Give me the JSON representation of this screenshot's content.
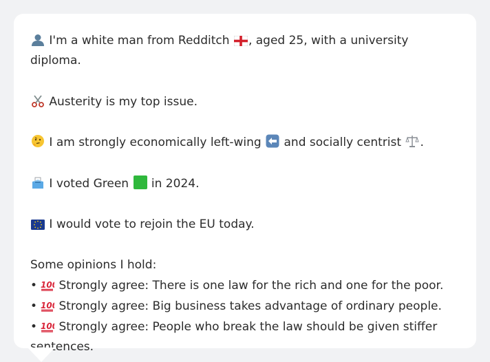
{
  "profile": {
    "identity": {
      "icon": "person-silhouette-icon",
      "text_before_flag": "I'm a white man from Redditch",
      "flag_icon": "england-flag-icon",
      "text_after_flag": ", aged 25, with a university diploma."
    },
    "top_issue": {
      "icon": "scissors-icon",
      "text": "Austerity is my top issue."
    },
    "ideology": {
      "icon": "thinking-face-icon",
      "text_before_arrow": "I am strongly economically left-wing",
      "arrow_icon": "left-arrow-icon",
      "text_middle": "and socially centrist",
      "scales_icon": "balance-scale-icon",
      "text_after": "."
    },
    "vote_2024": {
      "icon": "ballot-box-icon",
      "text_before_square": "I voted Green",
      "square_icon": "green-square-icon",
      "text_after_square": "in 2024."
    },
    "eu": {
      "icon": "eu-flag-icon",
      "text": "I would vote to rejoin the EU today."
    },
    "opinions_heading": "Some opinions I hold:",
    "opinions": [
      {
        "bullet": "•",
        "icon": "hundred-points-icon",
        "text": "Strongly agree: There is one law for the rich and one for the poor."
      },
      {
        "bullet": "•",
        "icon": "hundred-points-icon",
        "text": "Strongly agree: Big business takes advantage of ordinary people."
      },
      {
        "bullet": "•",
        "icon": "hundred-points-icon",
        "text": "Strongly agree: People who break the law should be given stiffer sentences."
      }
    ]
  },
  "colors": {
    "background": "#f1f2f4",
    "card": "#ffffff",
    "text": "#2b2b2b",
    "green_square": "#2fb83c",
    "eu_blue": "#1a3a8f",
    "hundred_red": "#d9263a"
  }
}
